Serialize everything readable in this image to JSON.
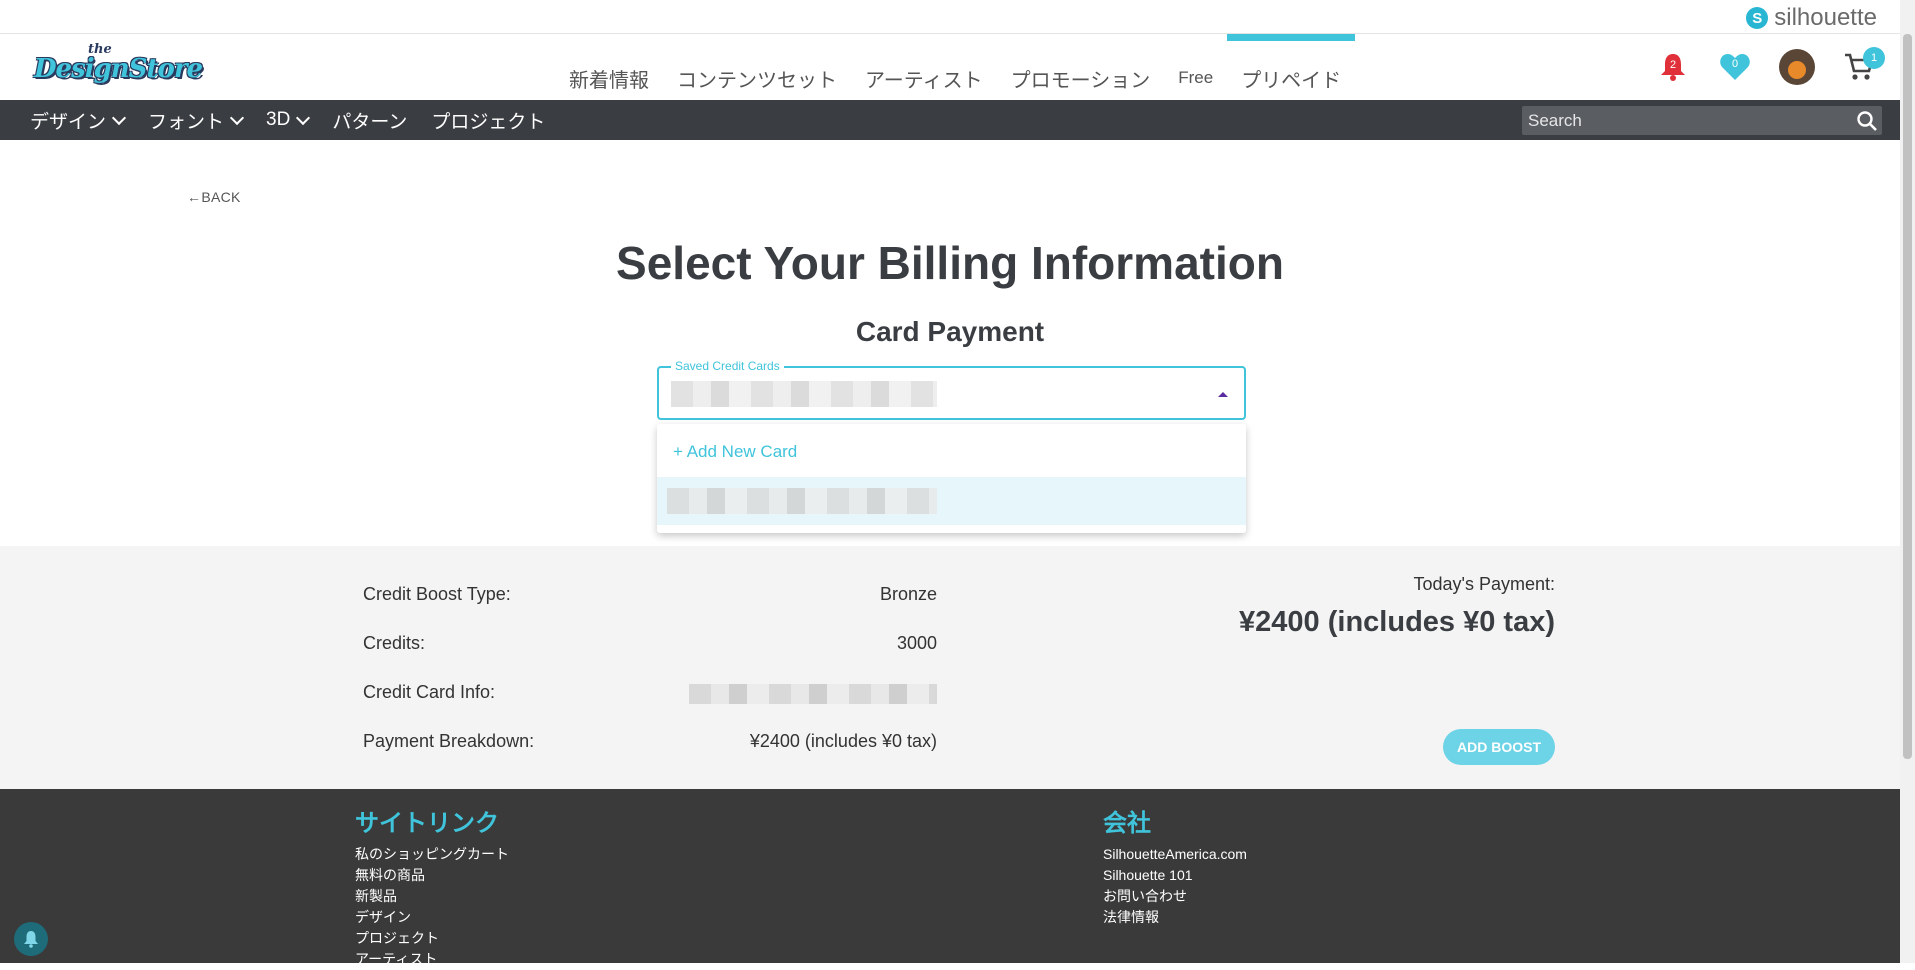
{
  "brand": {
    "silhouette_name": "silhouette"
  },
  "logo": {
    "line1": "the",
    "line2": "DesignStore"
  },
  "main_nav": [
    {
      "label": "新着情報"
    },
    {
      "label": "コンテンツセット"
    },
    {
      "label": "アーティスト"
    },
    {
      "label": "プロモーション"
    },
    {
      "label": "Free"
    },
    {
      "label": "プリペイド"
    }
  ],
  "header_icons": {
    "notifications_count": "2",
    "favorites_count": "0",
    "cart_count": "1"
  },
  "categories": [
    {
      "label": "デザイン"
    },
    {
      "label": "フォント"
    },
    {
      "label": "3D"
    },
    {
      "label": "パターン"
    },
    {
      "label": "プロジェクト"
    }
  ],
  "search": {
    "placeholder": "Search"
  },
  "page": {
    "back_label": "BACK",
    "title": "Select Your Billing Information",
    "subtitle": "Card Payment"
  },
  "card_select": {
    "legend": "Saved Credit Cards",
    "add_new": "+ Add New Card"
  },
  "summary": {
    "rows": [
      {
        "label": "Credit Boost Type:",
        "value": "Bronze"
      },
      {
        "label": "Credits:",
        "value": "3000"
      },
      {
        "label": "Credit Card Info:",
        "value": ""
      },
      {
        "label": "Payment Breakdown:",
        "value": "¥2400 (includes ¥0 tax)"
      }
    ],
    "today_label": "Today's Payment:",
    "today_amount": "¥2400 (includes ¥0 tax)",
    "button": "ADD BOOST"
  },
  "footer": {
    "site_links_title": "サイトリンク",
    "site_links": [
      "私のショッピングカート",
      "無料の商品",
      "新製品",
      "デザイン",
      "プロジェクト",
      "アーティスト"
    ],
    "company_title": "会社",
    "company_links": [
      "SilhouetteAmerica.com",
      "Silhouette 101",
      "お問い合わせ",
      "法律情報"
    ]
  },
  "colors": {
    "accent": "#3fc4db",
    "nav_bar": "#3a3d42",
    "footer": "#3a3a3a",
    "alert": "#e0303a"
  }
}
